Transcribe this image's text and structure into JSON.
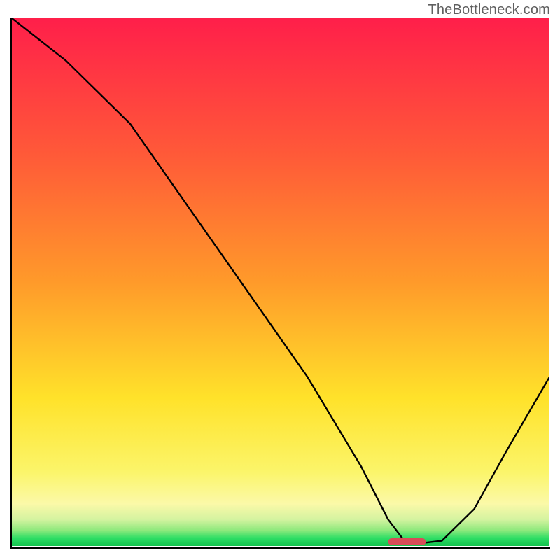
{
  "watermark": "TheBottleneck.com",
  "colors": {
    "red_top": "#ff1f4a",
    "orange_mid": "#ff9a2a",
    "yellow": "#ffe22a",
    "pale_yellow": "#fbf9a8",
    "green_band_light": "#8fe97d",
    "green_band": "#2fde66",
    "green_bottom": "#11c24c",
    "line": "#000000",
    "marker": "#d84c58",
    "axis": "#000000"
  },
  "chart_data": {
    "type": "line",
    "title": "",
    "xlabel": "",
    "ylabel": "",
    "xlim": [
      0,
      100
    ],
    "ylim": [
      0,
      100
    ],
    "grid": false,
    "legend": false,
    "annotations": [
      "TheBottleneck.com"
    ],
    "gradient_bands_note": "Background vertical gradient from red (top, high bottleneck) through orange and yellow to green (bottom, optimal).",
    "series": [
      {
        "name": "bottleneck-curve",
        "x": [
          0,
          10,
          22,
          33,
          44,
          55,
          65,
          70,
          73,
          76,
          80,
          86,
          92,
          100
        ],
        "y": [
          100,
          92,
          80,
          64,
          48,
          32,
          15,
          5,
          1,
          0.5,
          1,
          7,
          18,
          32
        ]
      }
    ],
    "optimum_marker": {
      "x_start": 70,
      "x_end": 77,
      "y": 0.8
    }
  }
}
